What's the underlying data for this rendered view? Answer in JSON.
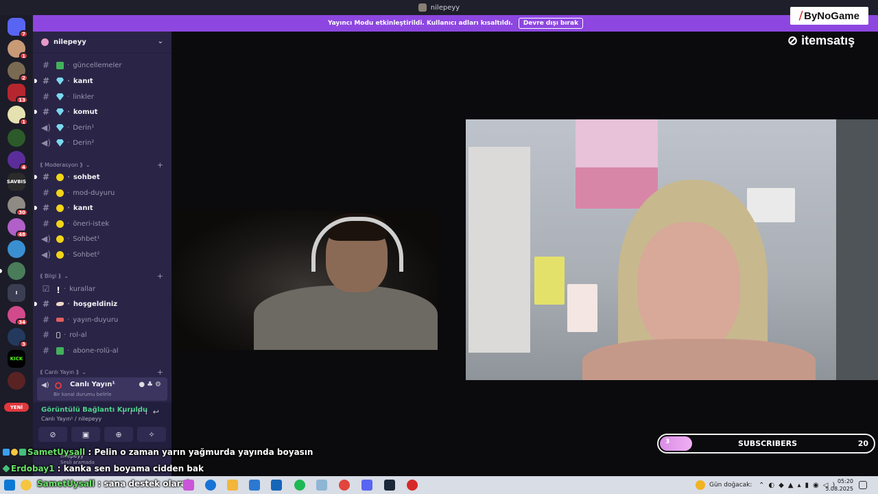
{
  "window": {
    "title": "nilepeyy"
  },
  "banner": {
    "text": "Yayıncı Modu etkinleştirildi. Kullanıcı adları kısaltıldı.",
    "button": "Devre dışı bırak"
  },
  "server_rail": {
    "badges": [
      "7",
      "1",
      "2",
      "13",
      "1",
      "4",
      "30",
      "48",
      "34",
      "3"
    ],
    "labels": {
      "savbis": "SAVBIS",
      "kick": "KICK",
      "tl": "I"
    },
    "new_label": "YENİ"
  },
  "guild": {
    "name": "nilepeyy"
  },
  "channels": [
    {
      "name": "güncellemeler",
      "unread": false
    },
    {
      "name": "kanıt",
      "unread": true
    },
    {
      "name": "linkler",
      "unread": false
    },
    {
      "name": "komut",
      "unread": true
    },
    {
      "name": "Derin¹",
      "unread": false
    },
    {
      "name": "Derin²",
      "unread": false
    }
  ],
  "categories": {
    "moderasyon": "⟪ Moderasyon ⟫",
    "bilgi": "⟪ Bilgi ⟫",
    "canli": "⟪ Canlı Yayın ⟫"
  },
  "mod_channels": [
    {
      "name": "sohbet",
      "unread": true
    },
    {
      "name": "mod-duyuru",
      "unread": false
    },
    {
      "name": "kanıt",
      "unread": true
    },
    {
      "name": "öneri-istek",
      "unread": false
    },
    {
      "name": "Sohbet¹",
      "unread": false
    },
    {
      "name": "Sohbet²",
      "unread": false
    }
  ],
  "info_channels": [
    {
      "name": "kurallar",
      "unread": false
    },
    {
      "name": "hoşgeldiniz",
      "unread": true
    },
    {
      "name": "yayın-duyuru",
      "unread": false
    },
    {
      "name": "rol-al",
      "unread": false
    },
    {
      "name": "abone-rolü-al",
      "unread": false
    }
  ],
  "voice_active": {
    "name": "Canlı Yayın¹",
    "status": "Bir kanal durumu belirle"
  },
  "connection": {
    "title": "Görüntülü Bağlantı Kuruldu",
    "sub": "Canlı Yayın¹ / nilepeyy"
  },
  "user": {
    "name": "nilepeyy",
    "status": "Sesli aramada"
  },
  "brand": {
    "bynogame": "ByNoGame",
    "itemsatis": "itemsatış"
  },
  "subgoal": {
    "current": "3",
    "label": "SUBSCRIBERS",
    "target": "20",
    "progress": 0.15
  },
  "chat": [
    {
      "user": "SametUysall",
      "message": "Pelin o zaman yarın yağmurda yayında boyasın"
    },
    {
      "user": "Erdobay1",
      "message": "kanka sen boyama cidden bak"
    },
    {
      "user": "SametUysall",
      "message": "sana destek olarak"
    }
  ],
  "taskbar": {
    "weather": "Gün doğacak",
    "time": "05:20",
    "date": "5.08.2025"
  },
  "colors": {
    "accent": "#8d47e0",
    "sidebar": "#2a2547",
    "rail": "#1b1c28",
    "online": "#4dd18c"
  }
}
